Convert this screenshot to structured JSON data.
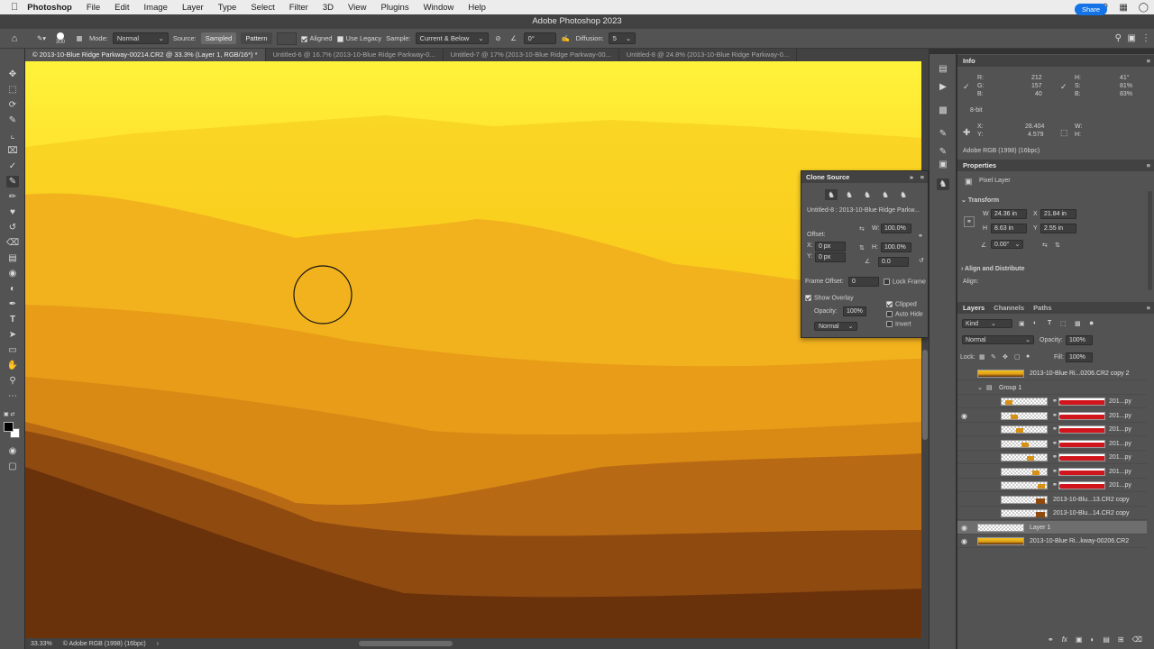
{
  "menubar": {
    "app": "Photoshop",
    "items": [
      "File",
      "Edit",
      "Image",
      "Layer",
      "Type",
      "Select",
      "Filter",
      "3D",
      "View",
      "Plugins",
      "Window",
      "Help"
    ]
  },
  "window_title": "Adobe Photoshop 2023",
  "options": {
    "brush_size": "300",
    "mode_label": "Mode:",
    "mode_value": "Normal",
    "source_label": "Source:",
    "sampled_btn": "Sampled",
    "pattern_btn": "Pattern",
    "aligned_label": "Aligned",
    "legacy_label": "Use Legacy",
    "sample_label": "Sample:",
    "sample_value": "Current & Below",
    "angle_value": "0°",
    "diffusion_label": "Diffusion:",
    "diffusion_value": "5",
    "share_label": "Share"
  },
  "tabs": [
    {
      "label": "© 2013-10-Blue Ridge Parkway-00214.CR2 @ 33.3% (Layer 1, RGB/16*) *",
      "active": true
    },
    {
      "label": "Untitled-6 @ 16.7% (2013-10-Blue Ridge Parkway-0...",
      "active": false
    },
    {
      "label": "Untitled-7 @ 17% (2013-10-Blue Ridge Parkway-00...",
      "active": false
    },
    {
      "label": "Untitled-8 @ 24.8% (2013-10-Blue Ridge Parkway-0...",
      "active": false
    }
  ],
  "status": {
    "zoom": "33.33%",
    "profile": "© Adobe RGB (1998) (16bpc)"
  },
  "info": {
    "title": "Info",
    "r_label": "R:",
    "g_label": "G:",
    "b_label": "B:",
    "r": "212",
    "g": "157",
    "b": "40",
    "h_label": "H:",
    "s_label": "S:",
    "br_label": "B:",
    "h": "41°",
    "s": "81%",
    "br": "83%",
    "bit": "8-bit",
    "x_label": "X:",
    "y_label": "Y:",
    "w_label": "W:",
    "ht_label": "H:",
    "x": "28.404",
    "y": "4.579",
    "profile": "Adobe RGB (1998) (16bpc)"
  },
  "properties": {
    "title": "Properties",
    "kind": "Pixel Layer",
    "transform": "Transform",
    "w_label": "W",
    "w": "24.36 in",
    "x_label": "X",
    "x": "21.84 in",
    "h_label": "H",
    "h": "8.63 in",
    "y_label": "Y",
    "y": "2.55 in",
    "angle": "0.00°",
    "align": "Align and Distribute",
    "align_label": "Align:"
  },
  "clone_source": {
    "title": "Clone Source",
    "source_name": "Untitled-8 : 2013-10-Blue Ridge Parkw...",
    "offset_label": "Offset:",
    "x_label": "X:",
    "ox": "0 px",
    "y_label": "Y:",
    "oy": "0 px",
    "w_label": "W:",
    "w": "100.0%",
    "h_label": "H:",
    "h": "100.0%",
    "angle": "0.0",
    "frame_offset_label": "Frame Offset:",
    "frame_offset": "0",
    "lock_frame": "Lock Frame",
    "show_overlay": "Show Overlay",
    "opacity_label": "Opacity:",
    "opacity": "100%",
    "clipped": "Clipped",
    "auto_hide": "Auto Hide",
    "invert": "Invert",
    "blend": "Normal"
  },
  "layers_panel": {
    "tabs": [
      "Layers",
      "Channels",
      "Paths"
    ],
    "kind": "Kind",
    "blend": "Normal",
    "opacity_label": "Opacity:",
    "opacity": "100%",
    "lock_label": "Lock:",
    "fill_label": "Fill:",
    "fill": "100%",
    "layers": [
      {
        "name": "2013-10-Blue Ri...0206.CR2 copy 2",
        "type": "image"
      },
      {
        "name": "Group 1",
        "type": "group"
      },
      {
        "name": "201...py",
        "type": "masked",
        "notch": 0
      },
      {
        "name": "201...py",
        "type": "masked",
        "notch": 1
      },
      {
        "name": "201...py",
        "type": "masked",
        "notch": 2
      },
      {
        "name": "201...py",
        "type": "masked",
        "notch": 3
      },
      {
        "name": "201...py",
        "type": "masked",
        "notch": 4
      },
      {
        "name": "201...py",
        "type": "masked",
        "notch": 5
      },
      {
        "name": "201...py",
        "type": "masked",
        "notch": 6
      },
      {
        "name": "2013-10-Blu...13.CR2 copy",
        "type": "partial"
      },
      {
        "name": "2013-10-Blu...14.CR2 copy",
        "type": "partial"
      },
      {
        "name": "Layer 1",
        "type": "blank"
      },
      {
        "name": "2013-10-Blue Ri...kway-00206.CR2",
        "type": "image"
      }
    ]
  }
}
